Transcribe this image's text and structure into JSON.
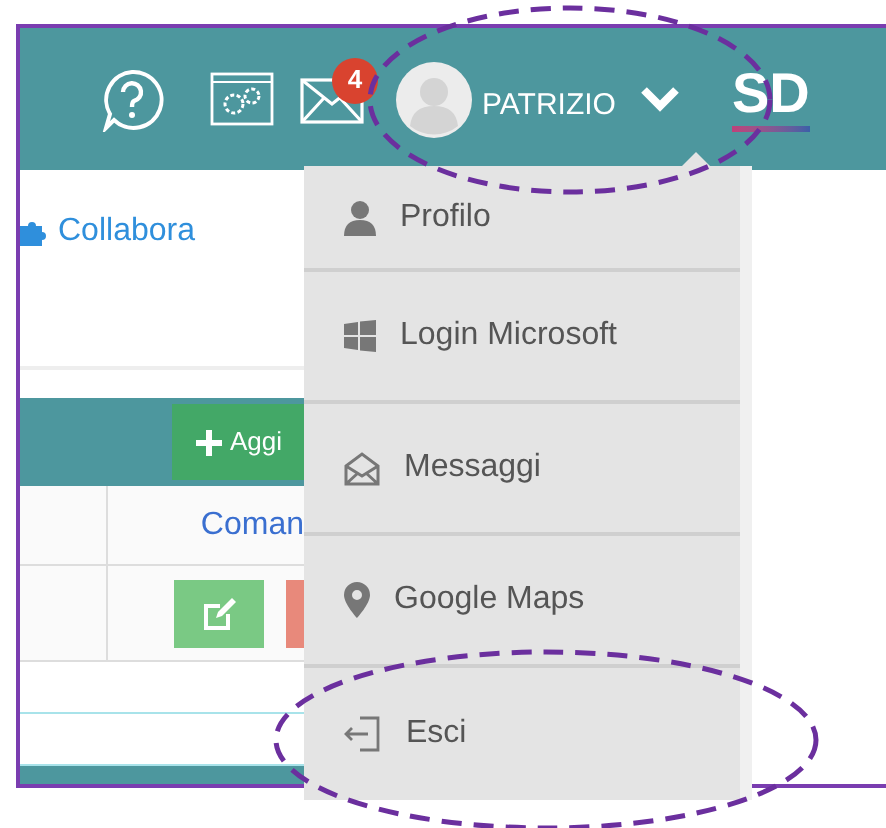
{
  "header": {
    "mail_badge": "4",
    "user_name": "PATRIZIO",
    "logo": "SD"
  },
  "content": {
    "link": "Collabora",
    "add_button": "Aggi",
    "column_2": "Coman"
  },
  "menu": {
    "items": [
      {
        "kind": "profile",
        "label": "Profilo"
      },
      {
        "kind": "windows",
        "label": "Login Microsoft"
      },
      {
        "kind": "messages",
        "label": "Messaggi"
      },
      {
        "kind": "map",
        "label": "Google Maps"
      },
      {
        "kind": "logout",
        "label": "Esci"
      }
    ]
  }
}
